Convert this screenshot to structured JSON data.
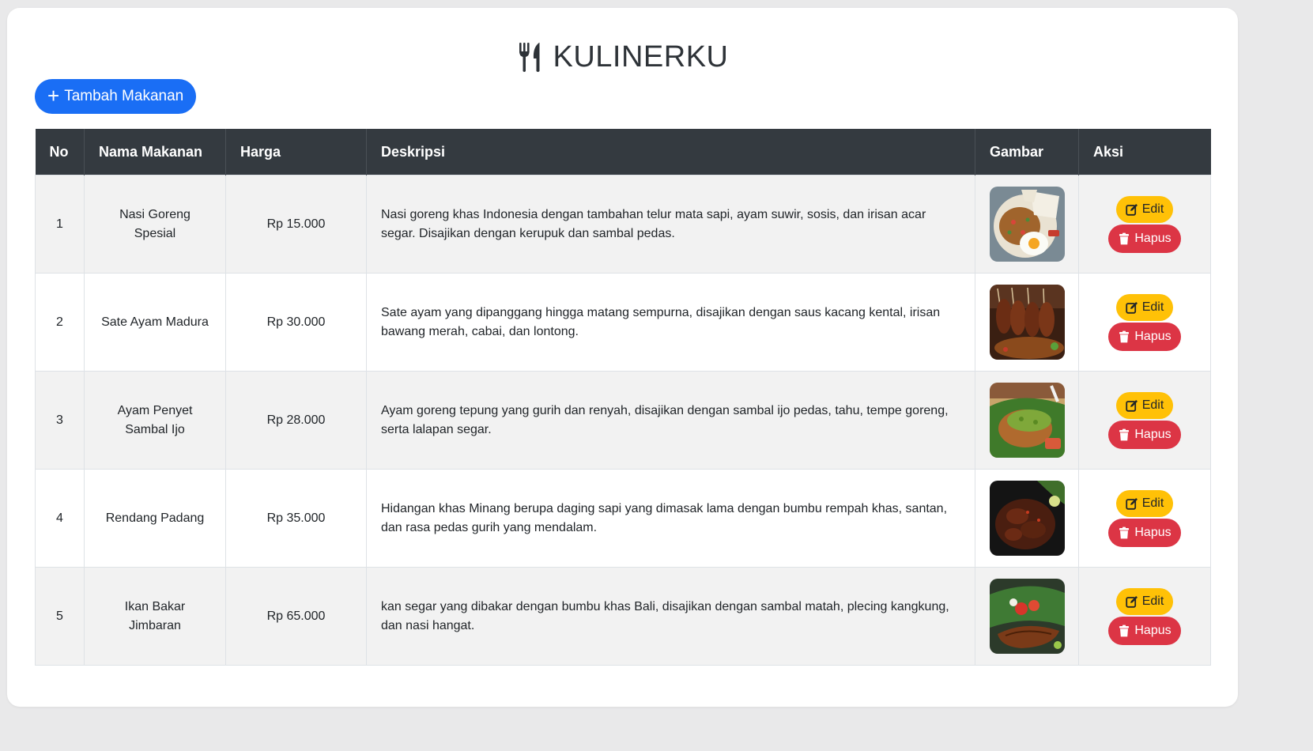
{
  "app": {
    "title": "KULINERKU",
    "title_icon": "utensils-icon"
  },
  "toolbar": {
    "add_label": "Tambah Makanan",
    "add_icon": "plus-icon",
    "accent": "#1a6ef5"
  },
  "table": {
    "headers": [
      "No",
      "Nama Makanan",
      "Harga",
      "Deskripsi",
      "Gambar",
      "Aksi"
    ],
    "rows": [
      {
        "no": "1",
        "name": "Nasi Goreng Spesial",
        "price": "Rp 15.000",
        "desc": "Nasi goreng khas Indonesia dengan tambahan telur mata sapi, ayam suwir, sosis, dan irisan acar segar. Disajikan dengan kerupuk dan sambal pedas.",
        "image": "nasi-goreng-photo",
        "edit_label": "Edit",
        "delete_label": "Hapus"
      },
      {
        "no": "2",
        "name": "Sate Ayam Madura",
        "price": "Rp 30.000",
        "desc": "Sate ayam yang dipanggang hingga matang sempurna, disajikan dengan saus kacang kental, irisan bawang merah, cabai, dan lontong.",
        "image": "sate-ayam-photo",
        "edit_label": "Edit",
        "delete_label": "Hapus"
      },
      {
        "no": "3",
        "name": "Ayam Penyet Sambal Ijo",
        "price": "Rp 28.000",
        "desc": "Ayam goreng tepung yang gurih dan renyah, disajikan dengan sambal ijo pedas, tahu, tempe goreng, serta lalapan segar.",
        "image": "ayam-penyet-photo",
        "edit_label": "Edit",
        "delete_label": "Hapus"
      },
      {
        "no": "4",
        "name": "Rendang Padang",
        "price": "Rp 35.000",
        "desc": "Hidangan khas Minang berupa daging sapi yang dimasak lama dengan bumbu rempah khas, santan, dan rasa pedas gurih yang mendalam.",
        "image": "rendang-photo",
        "edit_label": "Edit",
        "delete_label": "Hapus"
      },
      {
        "no": "5",
        "name": "Ikan Bakar Jimbaran",
        "price": "Rp 65.000",
        "desc": "kan segar yang dibakar dengan bumbu khas Bali, disajikan dengan sambal matah, plecing kangkung, dan nasi hangat.",
        "image": "ikan-bakar-photo",
        "edit_label": "Edit",
        "delete_label": "Hapus"
      }
    ]
  },
  "colors": {
    "header_bg": "#343a40",
    "edit": "#ffc107",
    "delete": "#dc3545"
  }
}
